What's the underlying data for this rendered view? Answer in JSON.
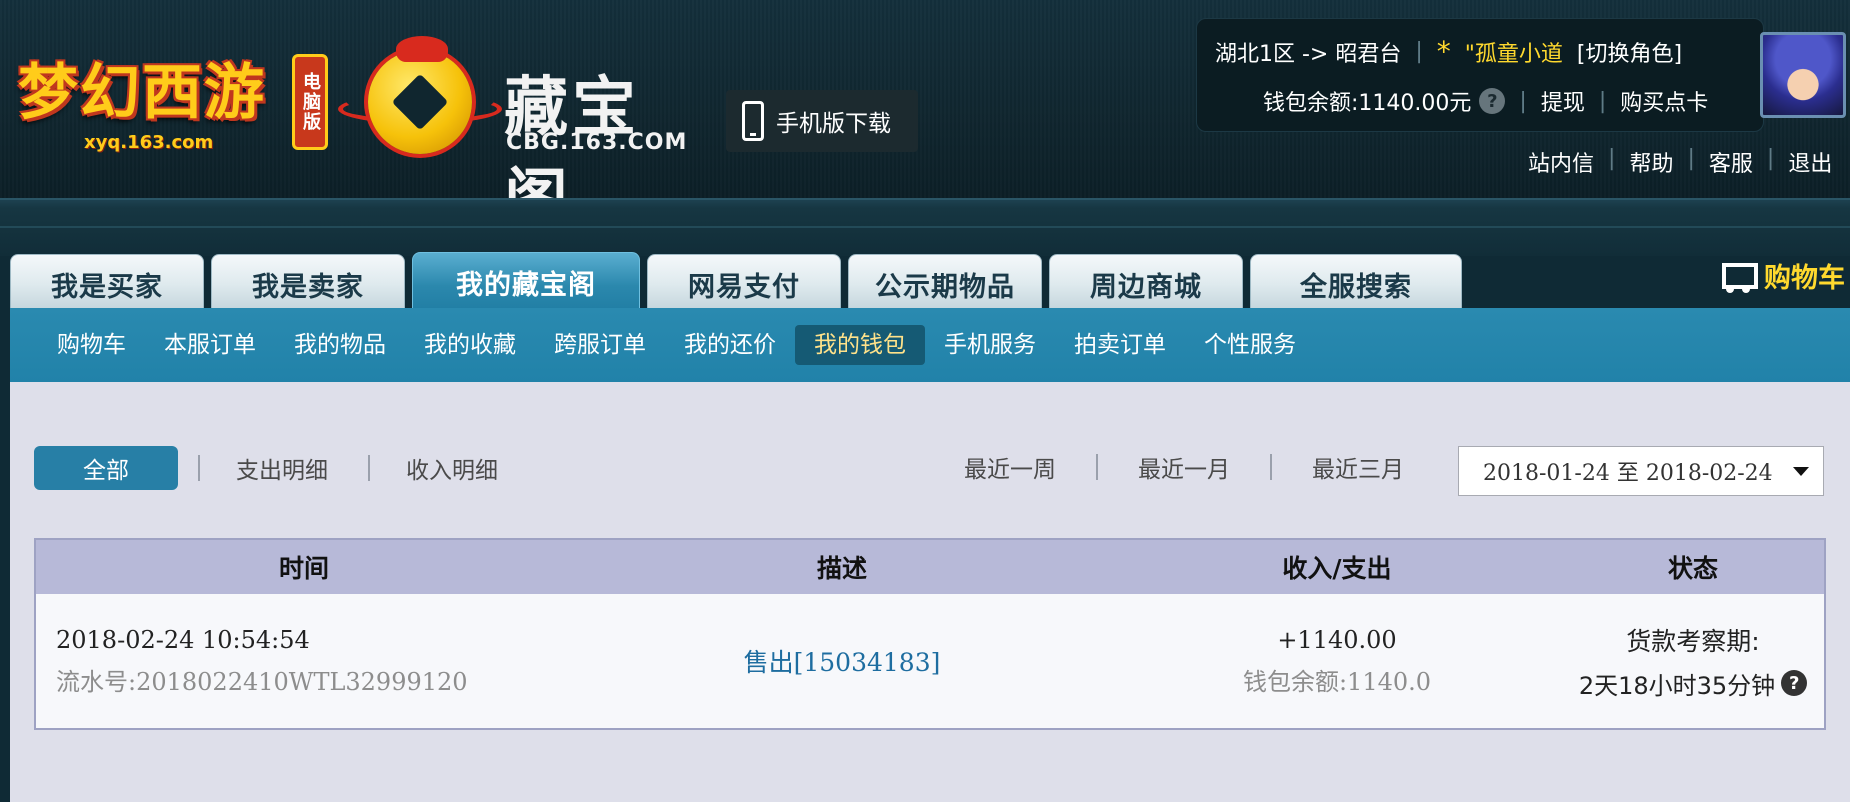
{
  "brand": {
    "game_logo_text": "梦幻西游",
    "game_logo_url": "xyq.163.com",
    "pc_badge": "电脑版",
    "site_title": "藏宝阁",
    "site_url": "CBG.163.COM"
  },
  "mobile_download": {
    "label": "手机版下载"
  },
  "user": {
    "server": "湖北1区 -> 昭君台",
    "role_prefix": "*",
    "role_name": "\"孤童小道",
    "switch_role": "[切换角色]",
    "wallet_label": "钱包余额:",
    "wallet_value": "1140.00元",
    "withdraw": "提现",
    "buy_card": "购买点卡"
  },
  "top_links": [
    "站内信",
    "帮助",
    "客服",
    "退出"
  ],
  "tabs": [
    {
      "label": "我是买家",
      "active": false
    },
    {
      "label": "我是卖家",
      "active": false
    },
    {
      "label": "我的藏宝阁",
      "active": true
    },
    {
      "label": "网易支付",
      "active": false
    },
    {
      "label": "公示期物品",
      "active": false
    },
    {
      "label": "周边商城",
      "active": false
    },
    {
      "label": "全服搜索",
      "active": false
    }
  ],
  "cart": {
    "label": "购物车"
  },
  "subnav": [
    {
      "label": "购物车",
      "active": false
    },
    {
      "label": "本服订单",
      "active": false
    },
    {
      "label": "我的物品",
      "active": false
    },
    {
      "label": "我的收藏",
      "active": false
    },
    {
      "label": "跨服订单",
      "active": false
    },
    {
      "label": "我的还价",
      "active": false
    },
    {
      "label": "我的钱包",
      "active": true
    },
    {
      "label": "手机服务",
      "active": false
    },
    {
      "label": "拍卖订单",
      "active": false
    },
    {
      "label": "个性服务",
      "active": false
    }
  ],
  "filters": {
    "type": {
      "all": "全部",
      "expense": "支出明细",
      "income": "收入明细"
    },
    "range": {
      "week": "最近一周",
      "month": "最近一月",
      "quarter": "最近三月"
    },
    "date_range": "2018-01-24 至 2018-02-24"
  },
  "table": {
    "headers": {
      "time": "时间",
      "desc": "描述",
      "amount": "收入/支出",
      "status": "状态"
    },
    "rows": [
      {
        "time": "2018-02-24 10:54:54",
        "serial": "流水号:2018022410WTL32999120",
        "desc": "售出[15034183]",
        "amount": "+1140.00",
        "balance": "钱包余额:1140.0",
        "status": "货款考察期:",
        "status_detail": "2天18小时35分钟"
      }
    ]
  },
  "colors": {
    "header_bg": "#10262f",
    "tab_active": "#2b88ad",
    "subnav_bg": "#2182a9",
    "accent_yellow": "#ffd92e",
    "content_bg": "#dedfea",
    "link_blue": "#1e6da0"
  }
}
